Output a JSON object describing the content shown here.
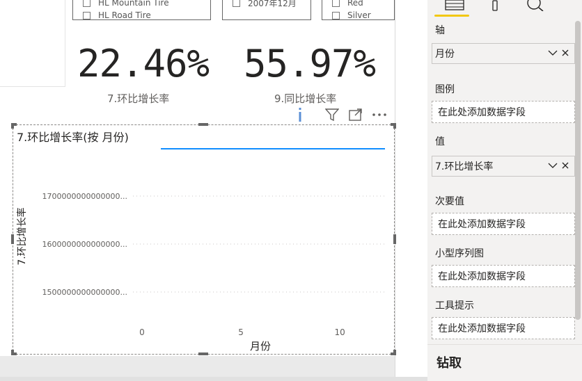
{
  "slicers": {
    "products": [
      "HL Mountain Tire",
      "HL Road Tire"
    ],
    "dates": [
      "2007年12月"
    ],
    "colors": [
      "Red",
      "Silver"
    ]
  },
  "kpis": [
    {
      "value": "22.46%",
      "label": "7.环比增长率"
    },
    {
      "value": "55.97%",
      "label": "9.同比增长率"
    }
  ],
  "visual_header": {
    "icons": [
      "info-icon",
      "filter-icon",
      "focus-mode-icon",
      "more-options-icon"
    ]
  },
  "chart_data": {
    "type": "line",
    "title": "7.环比增长率(按 月份)",
    "xlabel": "月份",
    "ylabel": "7.环比增长率",
    "x_ticks": [
      0,
      5,
      10
    ],
    "xlim": [
      0,
      12
    ],
    "y_ticks": [
      "1500000000000000...",
      "1600000000000000...",
      "1700000000000000..."
    ],
    "grid": true,
    "legend_color": "#118dff",
    "series": []
  },
  "fields_pane": {
    "tabs": [
      "fields-format-icon",
      "format-brush-icon",
      "analytics-icon"
    ],
    "sections": [
      {
        "label": "轴",
        "field": "月份"
      },
      {
        "label": "图例",
        "placeholder": "在此处添加数据字段"
      },
      {
        "label": "值",
        "field": "7.环比增长率"
      },
      {
        "label": "次要值",
        "placeholder": "在此处添加数据字段"
      },
      {
        "label": "小型序列图",
        "placeholder": "在此处添加数据字段"
      },
      {
        "label": "工具提示",
        "placeholder": "在此处添加数据字段"
      }
    ],
    "drill_label": "钻取"
  },
  "colors": {
    "accent": "#118dff",
    "tab_highlight": "#f2c811"
  }
}
